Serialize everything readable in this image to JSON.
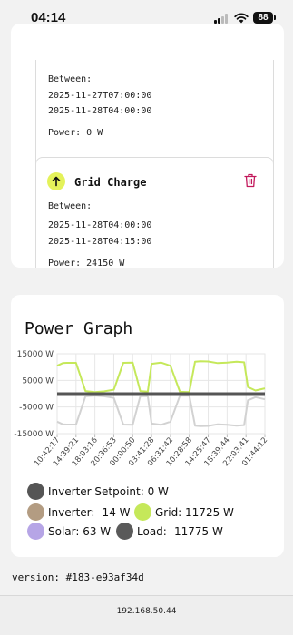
{
  "status_bar": {
    "time": "04:14",
    "battery": "88"
  },
  "schedules": [
    {
      "title": "",
      "between_label": "Between:",
      "start": "2025-11-27T07:00:00",
      "end": "2025-11-28T04:00:00",
      "power": "Power: 0 W"
    },
    {
      "title": "Grid Charge",
      "between_label": "Between:",
      "start": "2025-11-28T04:00:00",
      "end": "2025-11-28T04:15:00",
      "power": "Power: 24150 W"
    }
  ],
  "graph": {
    "title": "Power Graph"
  },
  "chart_data": {
    "type": "line",
    "title": "Power Graph",
    "xlabel": "",
    "ylabel": "",
    "ylim": [
      -15000,
      15000
    ],
    "yticks": [
      "15000 W",
      "5000 W",
      "-5000 W",
      "-15000 W"
    ],
    "ytick_values": [
      15000,
      5000,
      -5000,
      -15000
    ],
    "x_ticks": [
      "10:42:17",
      "14:39:21",
      "18:03:16",
      "20:36:53",
      "00:00:50",
      "03:41:28",
      "06:31:42",
      "10:28:58",
      "14:25:47",
      "18:39:44",
      "22:03:41",
      "01:44:12"
    ],
    "grid": true,
    "x": [
      0,
      0.3,
      0.5,
      1,
      1.5,
      2,
      2.5,
      3,
      3.5,
      4,
      4.4,
      4.8,
      5,
      5.5,
      6,
      6.5,
      7,
      7.3,
      7.6,
      8,
      8.5,
      9,
      9.5,
      9.9,
      10.1,
      10.5,
      11
    ],
    "series": [
      {
        "name": "Grid: 11725 W",
        "color": "#c5e85a",
        "values": [
          10500,
          11500,
          11600,
          11600,
          1000,
          600,
          900,
          1500,
          11600,
          11700,
          1000,
          800,
          11200,
          11700,
          10500,
          700,
          600,
          12000,
          12200,
          12100,
          11500,
          11700,
          12000,
          11800,
          2500,
          1200,
          2000
        ]
      },
      {
        "name": "Load: -11775 W",
        "color": "#d2d2d2",
        "values": [
          -10500,
          -11500,
          -11600,
          -11600,
          -1000,
          -700,
          -1000,
          -1600,
          -11600,
          -11700,
          -1000,
          -900,
          -11200,
          -11700,
          -10500,
          -800,
          -700,
          -12000,
          -12200,
          -12100,
          -11500,
          -11700,
          -12000,
          -11800,
          -2500,
          -1300,
          -2100
        ]
      },
      {
        "name": "Inverter Setpoint: 0 W",
        "color": "#555555",
        "values": [
          0,
          0,
          0,
          0,
          0,
          0,
          0,
          0,
          0,
          0,
          0,
          0,
          0,
          0,
          0,
          0,
          0,
          0,
          0,
          0,
          0,
          0,
          0,
          0,
          0,
          0,
          0
        ]
      }
    ],
    "legend": [
      {
        "label": "Inverter Setpoint: 0 W",
        "color": "#555555"
      },
      {
        "label": "Inverter: -14 W",
        "color": "#b39c82"
      },
      {
        "label": "Grid: 11725 W",
        "color": "#c5e85a"
      },
      {
        "label": "Solar: 63 W",
        "color": "#b6a5e6"
      },
      {
        "label": "Load: -11775 W",
        "color": "#5a5a5a"
      }
    ],
    "legend_position": "bottom"
  },
  "version": "version: #183-e93af34d",
  "footer": {
    "url": "192.168.50.44"
  }
}
